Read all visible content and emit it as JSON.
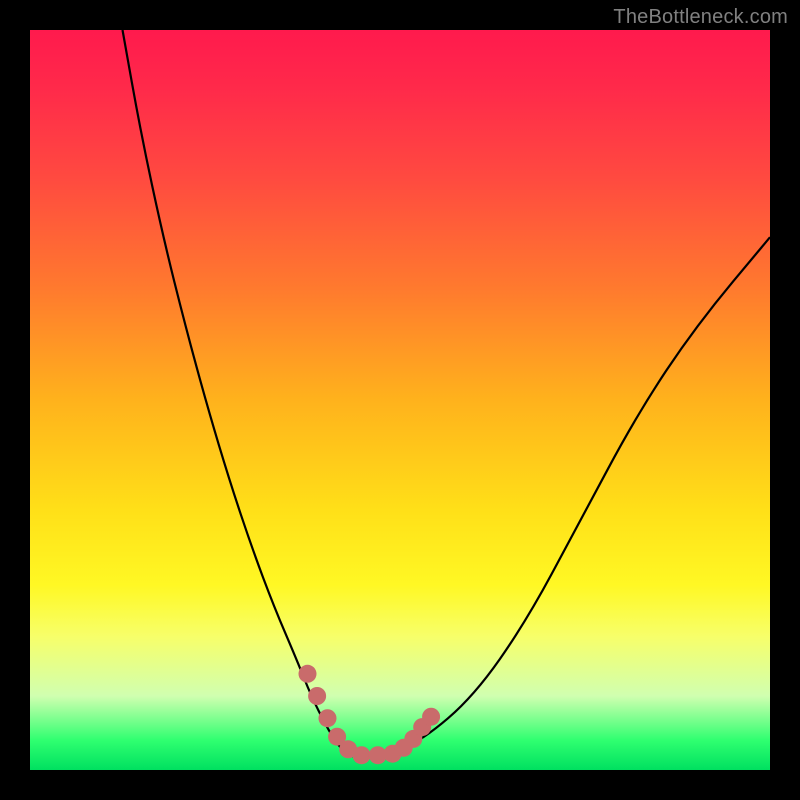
{
  "watermark": "TheBottleneck.com",
  "colors": {
    "curve": "#000000",
    "markers": "#c96b6b",
    "frame": "#000000"
  },
  "chart_data": {
    "type": "line",
    "title": "",
    "xlabel": "",
    "ylabel": "",
    "xlim": [
      0,
      100
    ],
    "ylim": [
      0,
      100
    ],
    "grid": false,
    "legend": false,
    "series": [
      {
        "name": "curve",
        "x": [
          12.5,
          15,
          18,
          21,
          24,
          27,
          30,
          33,
          36,
          38,
          40,
          41.5,
          43,
          45,
          48,
          53,
          60,
          67,
          74,
          82,
          90,
          100
        ],
        "y": [
          100,
          86,
          72,
          60,
          49,
          39,
          30,
          22,
          15,
          10,
          6,
          3.5,
          2,
          1.5,
          2,
          4,
          10,
          20,
          33,
          48,
          60,
          72
        ]
      }
    ],
    "markers": {
      "name": "highlight",
      "points": [
        {
          "x": 37.5,
          "y": 13.0
        },
        {
          "x": 38.8,
          "y": 10.0
        },
        {
          "x": 40.2,
          "y": 7.0
        },
        {
          "x": 41.5,
          "y": 4.5
        },
        {
          "x": 43.0,
          "y": 2.8
        },
        {
          "x": 44.8,
          "y": 2.0
        },
        {
          "x": 47.0,
          "y": 2.0
        },
        {
          "x": 49.0,
          "y": 2.2
        },
        {
          "x": 50.5,
          "y": 3.0
        },
        {
          "x": 51.8,
          "y": 4.2
        },
        {
          "x": 53.0,
          "y": 5.8
        },
        {
          "x": 54.2,
          "y": 7.2
        }
      ]
    }
  }
}
